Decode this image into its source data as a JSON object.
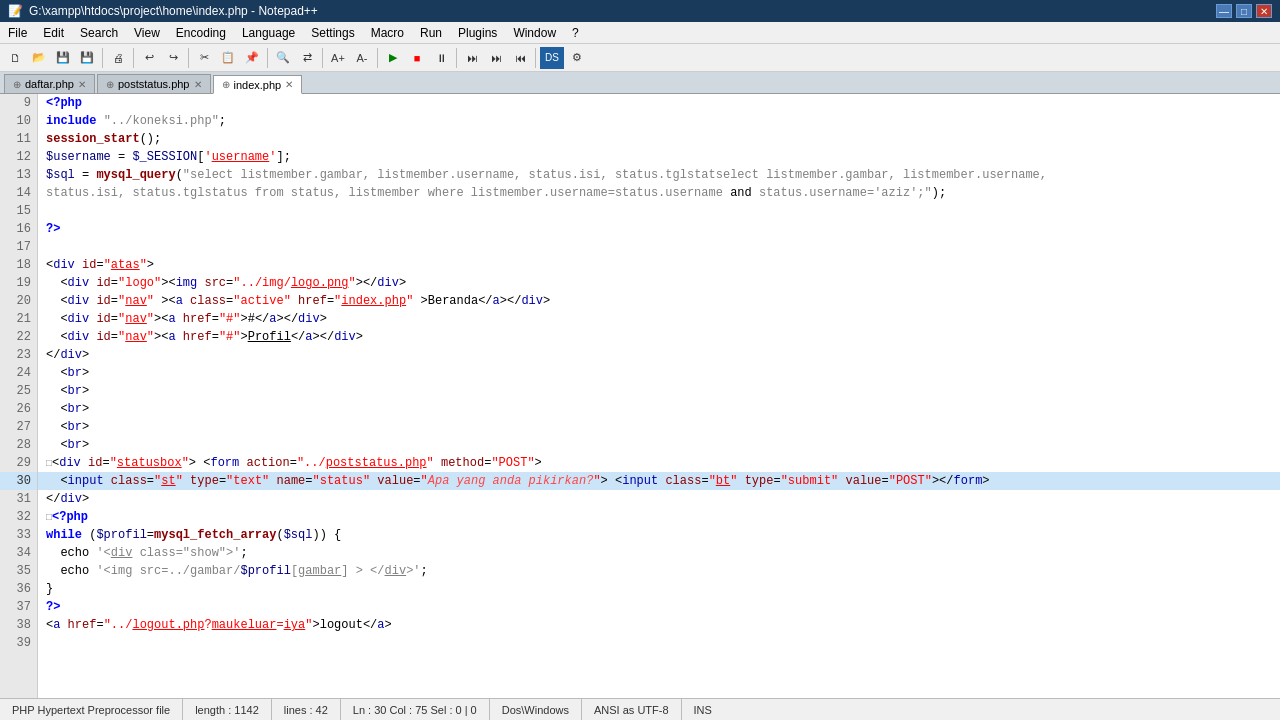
{
  "window": {
    "title": "G:\\xampp\\htdocs\\project\\home\\index.php - Notepad++",
    "controls": [
      "—",
      "□",
      "✕"
    ]
  },
  "menu": {
    "items": [
      "File",
      "Edit",
      "Search",
      "View",
      "Encoding",
      "Language",
      "Settings",
      "Macro",
      "Run",
      "Plugins",
      "Window",
      "?"
    ]
  },
  "tabs": [
    {
      "label": "daftar.php",
      "active": false,
      "closeable": true
    },
    {
      "label": "poststatus.php",
      "active": false,
      "closeable": true
    },
    {
      "label": "index.php",
      "active": true,
      "closeable": true
    }
  ],
  "lines": [
    {
      "num": 9,
      "content": "<?php",
      "highlight": false
    },
    {
      "num": 10,
      "content": "include \"../koneksi.php\";",
      "highlight": false
    },
    {
      "num": 11,
      "content": "session_start();",
      "highlight": false
    },
    {
      "num": 12,
      "content": "$username = $_SESSION['username'];",
      "highlight": false
    },
    {
      "num": 13,
      "content": "$sql = mysql_query(\"select listmember.gambar, listmember.username, status.isi, status.tglstatselect listmember.gambar, listmember.username,",
      "highlight": false
    },
    {
      "num": 14,
      "content": "status.isi, status.tglstatus from status, listmember where listmember.username=status.username and status.username='aziz';\");",
      "highlight": false
    },
    {
      "num": 15,
      "content": "",
      "highlight": false
    },
    {
      "num": 16,
      "content": "?>",
      "highlight": false
    },
    {
      "num": 17,
      "content": "",
      "highlight": false
    },
    {
      "num": 18,
      "content": "<div id=\"atas\">",
      "highlight": false
    },
    {
      "num": 19,
      "content": "  <div id=\"logo\"><img src=\"../img/logo.png\"></div>",
      "highlight": false
    },
    {
      "num": 20,
      "content": "  <div id=\"nav\" ><a class=\"active\" href=\"index.php\" >Beranda</a></div>",
      "highlight": false
    },
    {
      "num": 21,
      "content": "  <div id=\"nav\"><a href=\"#\">#</a></div>",
      "highlight": false
    },
    {
      "num": 22,
      "content": "  <div id=\"nav\"><a href=\"#\">Profil</a></div>",
      "highlight": false
    },
    {
      "num": 23,
      "content": "</div>",
      "highlight": false
    },
    {
      "num": 24,
      "content": "  <br>",
      "highlight": false
    },
    {
      "num": 25,
      "content": "  <br>",
      "highlight": false
    },
    {
      "num": 26,
      "content": "  <br>",
      "highlight": false
    },
    {
      "num": 27,
      "content": "  <br>",
      "highlight": false
    },
    {
      "num": 28,
      "content": "  <br>",
      "highlight": false
    },
    {
      "num": 29,
      "content": "<div id=\"statusbox\"> <form action=\"../poststatus.php\" method=\"POST\">",
      "highlight": false
    },
    {
      "num": 30,
      "content": "  <input class=\"st\" type=\"text\" name=\"status\" value=\"Apa yang anda pikirkan?\"> <input class=\"bt\" type=\"submit\" value=\"POST\"></form>",
      "highlight": true
    },
    {
      "num": 31,
      "content": "</div>",
      "highlight": false
    },
    {
      "num": 32,
      "content": "<?php",
      "highlight": false
    },
    {
      "num": 33,
      "content": "while ($profil=mysql_fetch_array($sql)) {",
      "highlight": false
    },
    {
      "num": 34,
      "content": "  echo '<div class=\"show\">';",
      "highlight": false
    },
    {
      "num": 35,
      "content": "  echo '<img src=../gambar/$profil[gambar] > </div>';",
      "highlight": false
    },
    {
      "num": 36,
      "content": "}",
      "highlight": false
    },
    {
      "num": 37,
      "content": "?>",
      "highlight": false
    },
    {
      "num": 38,
      "content": "<a href=\"../logout.php?maukeluar=iya\">logout</a>",
      "highlight": false
    },
    {
      "num": 39,
      "content": "",
      "highlight": false
    }
  ],
  "statusbar": {
    "filetype": "PHP Hypertext Preprocessor file",
    "length": "length : 1142",
    "lines": "lines : 42",
    "position": "Ln : 30    Col : 75    Sel : 0 | 0",
    "encoding": "Dos\\Windows",
    "charset": "ANSI as UTF-8",
    "ins": "INS"
  }
}
